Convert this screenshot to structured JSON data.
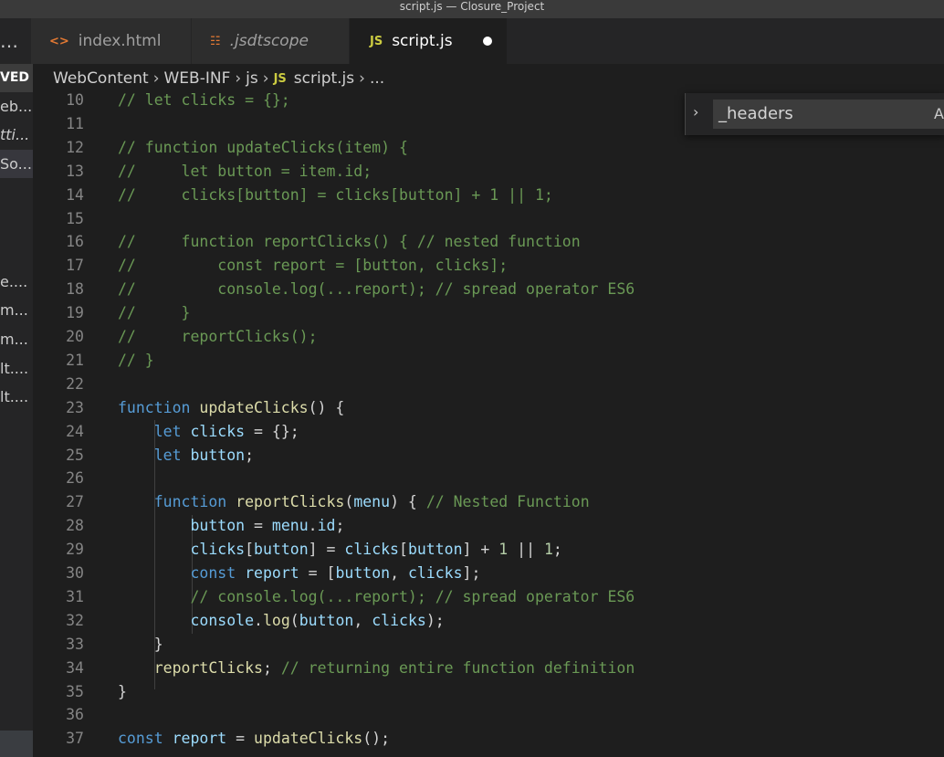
{
  "window": {
    "title": "script.js — Closure_Project"
  },
  "tabs": [
    {
      "label": "index.html",
      "icon": "html-file-icon",
      "icon_glyph": "<>",
      "icon_color": "#e37933"
    },
    {
      "label": ".jsdtscope",
      "icon": "rss-file-icon",
      "icon_glyph": "☷",
      "icon_color": "#e37933"
    },
    {
      "label": "script.js",
      "icon": "js-file-icon",
      "icon_glyph": "JS",
      "icon_color": "#cbcb41",
      "modified": true
    }
  ],
  "overflow_glyph": "…",
  "breadcrumb": [
    "WebContent",
    "WEB-INF",
    "js",
    "script.js",
    "..."
  ],
  "breadcrumb_js_glyph": "JS",
  "sidebar": {
    "saved_label": "VED",
    "items": [
      "eb...",
      "tti...",
      "So...",
      "e....",
      "m...",
      "m...",
      "lt....",
      "lt...."
    ]
  },
  "find_widget": {
    "value": "_headers",
    "toggle_glyph": "›",
    "case_glyph": "A"
  },
  "editor": {
    "lines": [
      {
        "n": "10",
        "t": [
          [
            "cm",
            "// let clicks = {};"
          ]
        ]
      },
      {
        "n": "11",
        "t": []
      },
      {
        "n": "12",
        "t": [
          [
            "cm",
            "// function updateClicks(item) {"
          ]
        ]
      },
      {
        "n": "13",
        "t": [
          [
            "cm",
            "//     let button = item.id;"
          ]
        ]
      },
      {
        "n": "14",
        "t": [
          [
            "cm",
            "//     clicks[button] = clicks[button] + 1 || 1;"
          ]
        ]
      },
      {
        "n": "15",
        "t": []
      },
      {
        "n": "16",
        "t": [
          [
            "cm",
            "//     function reportClicks() { // nested function"
          ]
        ]
      },
      {
        "n": "17",
        "t": [
          [
            "cm",
            "//         const report = [button, clicks];"
          ]
        ]
      },
      {
        "n": "18",
        "t": [
          [
            "cm",
            "//         console.log(...report); // spread operator ES6"
          ]
        ]
      },
      {
        "n": "19",
        "t": [
          [
            "cm",
            "//     }"
          ]
        ]
      },
      {
        "n": "20",
        "t": [
          [
            "cm",
            "//     reportClicks();"
          ]
        ]
      },
      {
        "n": "21",
        "t": [
          [
            "cm",
            "// }"
          ]
        ]
      },
      {
        "n": "22",
        "t": []
      },
      {
        "n": "23",
        "t": [
          [
            "kw",
            "function "
          ],
          [
            "fn",
            "updateClicks"
          ],
          [
            "pn",
            "() {"
          ]
        ]
      },
      {
        "n": "24",
        "t": [
          [
            "pn",
            "    "
          ],
          [
            "kw",
            "let "
          ],
          [
            "var",
            "clicks"
          ],
          [
            "pn",
            " = {};"
          ]
        ]
      },
      {
        "n": "25",
        "t": [
          [
            "pn",
            "    "
          ],
          [
            "kw",
            "let "
          ],
          [
            "var",
            "button"
          ],
          [
            "pn",
            ";"
          ]
        ]
      },
      {
        "n": "26",
        "t": []
      },
      {
        "n": "27",
        "t": [
          [
            "pn",
            "    "
          ],
          [
            "kw",
            "function "
          ],
          [
            "fn",
            "reportClicks"
          ],
          [
            "pn",
            "("
          ],
          [
            "var",
            "menu"
          ],
          [
            "pn",
            ") { "
          ],
          [
            "cm",
            "// Nested Function"
          ]
        ]
      },
      {
        "n": "28",
        "t": [
          [
            "pn",
            "        "
          ],
          [
            "var",
            "button"
          ],
          [
            "pn",
            " = "
          ],
          [
            "var",
            "menu"
          ],
          [
            "pn",
            "."
          ],
          [
            "var",
            "id"
          ],
          [
            "pn",
            ";"
          ]
        ]
      },
      {
        "n": "29",
        "t": [
          [
            "pn",
            "        "
          ],
          [
            "var",
            "clicks"
          ],
          [
            "pn",
            "["
          ],
          [
            "var",
            "button"
          ],
          [
            "pn",
            "] = "
          ],
          [
            "var",
            "clicks"
          ],
          [
            "pn",
            "["
          ],
          [
            "var",
            "button"
          ],
          [
            "pn",
            "] + "
          ],
          [
            "num",
            "1"
          ],
          [
            "pn",
            " || "
          ],
          [
            "num",
            "1"
          ],
          [
            "pn",
            ";"
          ]
        ]
      },
      {
        "n": "30",
        "t": [
          [
            "pn",
            "        "
          ],
          [
            "kw",
            "const "
          ],
          [
            "var",
            "report"
          ],
          [
            "pn",
            " = ["
          ],
          [
            "var",
            "button"
          ],
          [
            "pn",
            ", "
          ],
          [
            "var",
            "clicks"
          ],
          [
            "pn",
            "];"
          ]
        ]
      },
      {
        "n": "31",
        "t": [
          [
            "pn",
            "        "
          ],
          [
            "cm",
            "// console.log(...report); // spread operator ES6"
          ]
        ]
      },
      {
        "n": "32",
        "t": [
          [
            "pn",
            "        "
          ],
          [
            "var",
            "console"
          ],
          [
            "pn",
            "."
          ],
          [
            "fn",
            "log"
          ],
          [
            "pn",
            "("
          ],
          [
            "var",
            "button"
          ],
          [
            "pn",
            ", "
          ],
          [
            "var",
            "clicks"
          ],
          [
            "pn",
            ");"
          ]
        ]
      },
      {
        "n": "33",
        "t": [
          [
            "pn",
            "    }"
          ]
        ]
      },
      {
        "n": "34",
        "t": [
          [
            "pn",
            "    "
          ],
          [
            "fn",
            "reportClicks"
          ],
          [
            "pn",
            "; "
          ],
          [
            "cm",
            "// returning entire function definition"
          ]
        ]
      },
      {
        "n": "35",
        "t": [
          [
            "pn",
            "}"
          ]
        ]
      },
      {
        "n": "36",
        "t": []
      },
      {
        "n": "37",
        "t": [
          [
            "kw",
            "const "
          ],
          [
            "var",
            "report"
          ],
          [
            "pn",
            " = "
          ],
          [
            "fn",
            "updateClicks"
          ],
          [
            "pn",
            "();"
          ]
        ]
      }
    ]
  }
}
